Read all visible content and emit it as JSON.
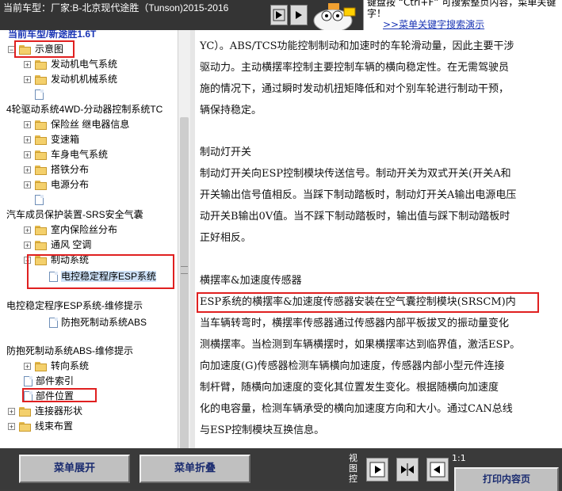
{
  "header": {
    "vehicle_label": "当前车型：厂家:B-北京现代途胜（Tunson)2015-2016",
    "tip_text": "键盘按 “Ctrl+F” 可搜索整页内容，菜单关键字！",
    "tip_link": ">>菜单关键字搜索演示"
  },
  "tree": {
    "partial_top": "当前车型/新途胜1.6T",
    "items": [
      {
        "label": "示意图"
      },
      {
        "label": "发动机电气系统"
      },
      {
        "label": "发动机机械系统"
      },
      {
        "label": "4轮驱动系统4WD-分动器控制系统TC"
      },
      {
        "label": "保险丝 继电器信息"
      },
      {
        "label": "变速箱"
      },
      {
        "label": "车身电气系统"
      },
      {
        "label": "搭铁分布"
      },
      {
        "label": "电源分布"
      },
      {
        "label": "汽车成员保护装置-SRS安全气囊"
      },
      {
        "label": "室内保险丝分布"
      },
      {
        "label": "通风 空调"
      },
      {
        "label": "制动系统"
      },
      {
        "label": "电控稳定程序ESP系统"
      },
      {
        "label": "电控稳定程序ESP系统-维修提示"
      },
      {
        "label": "防抱死制动系统ABS"
      },
      {
        "label": "防抱死制动系统ABS-维修提示"
      },
      {
        "label": "转向系统"
      },
      {
        "label": "部件索引"
      },
      {
        "label": "部件位置"
      },
      {
        "label": "连接器形状"
      },
      {
        "label": "线束布置"
      }
    ]
  },
  "content": {
    "lines": [
      "YC）。ABS/TCS功能控制制动和加速时的车轮滑动量，因此主要干涉",
      "驱动力。主动横摆率控制主要控制车辆的横向稳定性。在无需驾驶员",
      "施的情况下，通过瞬时发动机扭矩降低和对个别车轮进行制动干预，",
      "辆保持稳定。",
      "",
      "制动灯开关",
      "制动灯开关向ESP控制模块传送信号。制动开关为双式开关(开关A和",
      "开关输出信号值相反。当踩下制动踏板时，制动灯开关A输出电源电压",
      "动开关B输出0V值。当不踩下制动踏板时，输出值与踩下制动踏板时",
      "正好相反。",
      "",
      "横摆率&加速度传感器",
      "ESP系统的横摆率&加速度传感器安装在空气囊控制模块(SRSCM)内",
      "当车辆转弯时，横摆率传感器通过传感器内部平板拔叉的振动量变化",
      "测横摆率。当检测到车辆横摆时，如果横摆率达到临界值，激活ESP。",
      "向加速度(G)传感器检测车辆横向加速度，传感器内部小型元件连接",
      "制杆臂，随横向加速度的变化其位置发生变化。根据随横向加速度",
      "化的电容量，检测车辆承受的横向加速度方向和大小。通过CAN总线",
      "与ESP控制模块互换信息。"
    ]
  },
  "footer": {
    "expand_label": "菜单展开",
    "collapse_label": "菜单折叠",
    "view_control_label": "视图控",
    "ratio_label": "1:1",
    "print_label": "打印内容页"
  },
  "colors": {
    "highlight": "#e02020",
    "link": "#1a35b5",
    "button_text": "#1b2c70"
  }
}
